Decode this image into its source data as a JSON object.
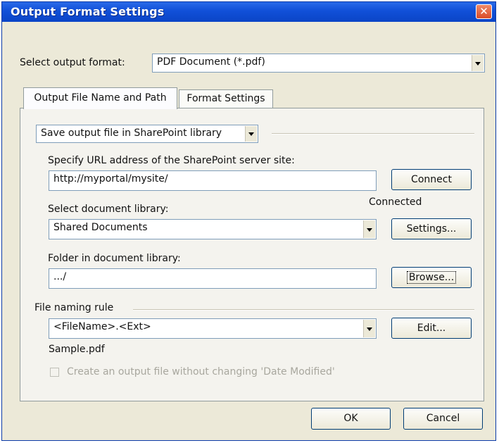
{
  "window": {
    "title": "Output Format Settings",
    "close_glyph": "✕"
  },
  "output_format": {
    "label": "Select output format:",
    "value": "PDF Document (*.pdf)"
  },
  "tabs": [
    {
      "label": "Output File Name and Path"
    },
    {
      "label": "Format Settings"
    }
  ],
  "save_mode": {
    "value": "Save output file in SharePoint library"
  },
  "url": {
    "label": "Specify URL address of the SharePoint server site:",
    "value": "http://myportal/mysite/",
    "connect_label": "Connect",
    "status": "Connected"
  },
  "library": {
    "label": "Select document library:",
    "value": "Shared Documents",
    "settings_label": "Settings..."
  },
  "folder": {
    "label": "Folder in document library:",
    "value": ".../",
    "browse_label": "Browse..."
  },
  "naming": {
    "label": "File naming rule",
    "value": "<FileName>.<Ext>",
    "edit_label": "Edit...",
    "sample": "Sample.pdf"
  },
  "keep_date": {
    "label": "Create an output file without changing 'Date Modified'",
    "checked": false
  },
  "footer": {
    "ok_label": "OK",
    "cancel_label": "Cancel"
  }
}
